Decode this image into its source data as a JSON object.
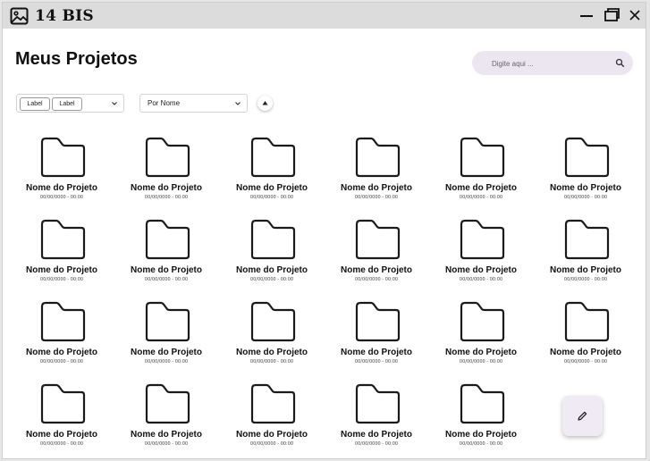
{
  "window": {
    "title": "14 BIS",
    "icon": "image-icon"
  },
  "page": {
    "title": "Meus Projetos"
  },
  "search": {
    "placeholder": "Digite aqui ..."
  },
  "filter": {
    "chips": [
      "Label",
      "Label"
    ]
  },
  "sort": {
    "selected": "Por Nome",
    "direction": "ascending"
  },
  "projects": [
    {
      "name": "Nome do Projeto",
      "date": "00/00/0000 - 00:00"
    },
    {
      "name": "Nome do Projeto",
      "date": "00/00/0000 - 00:00"
    },
    {
      "name": "Nome do Projeto",
      "date": "00/00/0000 - 00:00"
    },
    {
      "name": "Nome do Projeto",
      "date": "00/00/0000 - 00:00"
    },
    {
      "name": "Nome do Projeto",
      "date": "00/00/0000 - 00:00"
    },
    {
      "name": "Nome do Projeto",
      "date": "00/00/0000 - 00:00"
    },
    {
      "name": "Nome do Projeto",
      "date": "00/00/0000 - 00:00"
    },
    {
      "name": "Nome do Projeto",
      "date": "00/00/0000 - 00:00"
    },
    {
      "name": "Nome do Projeto",
      "date": "00/00/0000 - 00:00"
    },
    {
      "name": "Nome do Projeto",
      "date": "00/00/0000 - 00:00"
    },
    {
      "name": "Nome do Projeto",
      "date": "00/00/0000 - 00:00"
    },
    {
      "name": "Nome do Projeto",
      "date": "00/00/0000 - 00:00"
    },
    {
      "name": "Nome do Projeto",
      "date": "00/00/0000 - 00:00"
    },
    {
      "name": "Nome do Projeto",
      "date": "00/00/0000 - 00:00"
    },
    {
      "name": "Nome do Projeto",
      "date": "00/00/0000 - 00:00"
    },
    {
      "name": "Nome do Projeto",
      "date": "00/00/0000 - 00:00"
    },
    {
      "name": "Nome do Projeto",
      "date": "00/00/0000 - 00:00"
    },
    {
      "name": "Nome do Projeto",
      "date": "00/00/0000 - 00:00"
    },
    {
      "name": "Nome do Projeto",
      "date": "00/00/0000 - 00:00"
    },
    {
      "name": "Nome do Projeto",
      "date": "00/00/0000 - 00:00"
    },
    {
      "name": "Nome do Projeto",
      "date": "00/00/0000 - 00:00"
    },
    {
      "name": "Nome do Projeto",
      "date": "00/00/0000 - 00:00"
    },
    {
      "name": "Nome do Projeto",
      "date": "00/00/0000 - 00:00"
    }
  ],
  "fab": {
    "icon": "pencil-icon"
  },
  "colors": {
    "titlebar": "#dcdcdc",
    "search_bg": "#ebe6ef",
    "fab_bg": "#f0eaf4"
  }
}
